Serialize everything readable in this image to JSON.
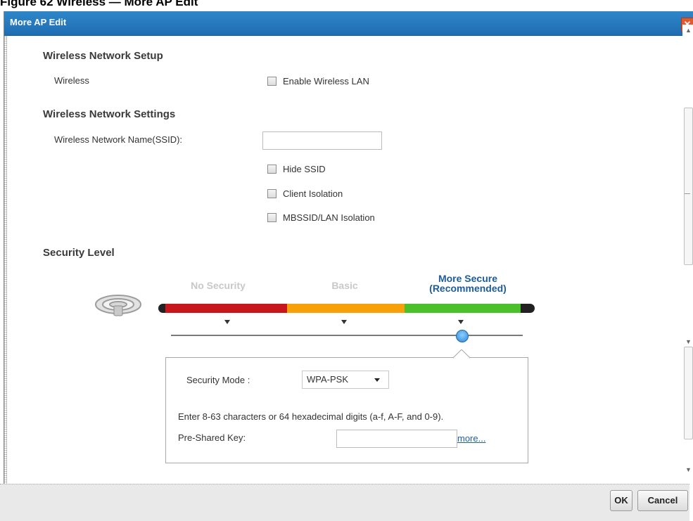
{
  "figure_caption": "Figure 62   Wireless — More AP Edit",
  "dialog": {
    "title": "More AP Edit",
    "close_label": "✕"
  },
  "setup": {
    "heading": "Wireless Network Setup",
    "wireless_label": "Wireless",
    "enable_label": "Enable Wireless LAN",
    "enable_checked": false
  },
  "settings": {
    "heading": "Wireless Network Settings",
    "ssid_label": "Wireless Network Name(SSID):",
    "ssid_value": "",
    "hide_ssid": "Hide SSID",
    "client_isolation": "Client Isolation",
    "mbssid": "MBSSID/LAN Isolation"
  },
  "security": {
    "heading": "Security Level",
    "levels": [
      "No Security",
      "Basic",
      "More Secure\n(Recommended)"
    ],
    "level_1": "No Security",
    "level_2": "Basic",
    "level_3_line1": "More Secure",
    "level_3_line2": "(Recommended)",
    "selected_index": 2,
    "colors": {
      "red": "#c8161d",
      "orange": "#f7a10a",
      "green": "#4cc02a",
      "accent": "#1c5c9a"
    },
    "mode_label": "Security Mode :",
    "mode_value": "WPA-PSK",
    "hint": "Enter 8-63 characters or 64 hexadecimal digits (a-f, A-F, and 0-9).",
    "psk_label": "Pre-Shared Key:",
    "psk_value": "",
    "more_link": "more..."
  },
  "buttons": {
    "ok": "OK",
    "cancel": "Cancel"
  }
}
